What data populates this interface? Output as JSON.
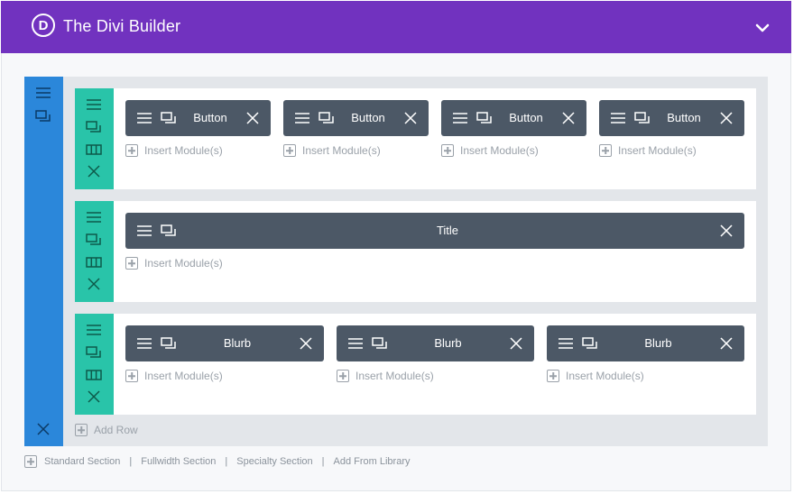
{
  "header": {
    "logo_letter": "D",
    "title": "The Divi Builder",
    "collapse_icon": "chevron-down-icon",
    "background": "#7132bf"
  },
  "colors": {
    "section_bar": "#2b87da",
    "row_bar": "#29c4a9",
    "module": "#4c5866"
  },
  "section": {
    "bar_icons": [
      "hamburger-icon",
      "duplicate-icon"
    ],
    "delete_icon": "close-icon",
    "add_row_label": "Add Row"
  },
  "rows": [
    {
      "modules": [
        {
          "label": "Button",
          "insert_label": "Insert Module(s)"
        },
        {
          "label": "Button",
          "insert_label": "Insert Module(s)"
        },
        {
          "label": "Button",
          "insert_label": "Insert Module(s)"
        },
        {
          "label": "Button",
          "insert_label": "Insert Module(s)"
        }
      ]
    },
    {
      "modules": [
        {
          "label": "Title",
          "insert_label": "Insert Module(s)"
        }
      ]
    },
    {
      "modules": [
        {
          "label": "Blurb",
          "insert_label": "Insert Module(s)"
        },
        {
          "label": "Blurb",
          "insert_label": "Insert Module(s)"
        },
        {
          "label": "Blurb",
          "insert_label": "Insert Module(s)"
        }
      ]
    }
  ],
  "footer": {
    "standard": "Standard Section",
    "separator": "|",
    "fullwidth": "Fullwidth Section",
    "specialty": "Specialty Section",
    "library": "Add From Library"
  }
}
